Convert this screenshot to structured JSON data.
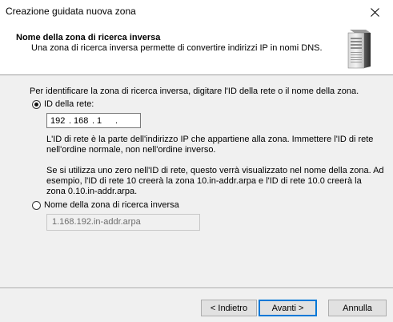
{
  "window": {
    "title": "Creazione guidata nuova zona"
  },
  "header": {
    "title": "Nome della zona di ricerca inversa",
    "subtitle": "Una zona di ricerca inversa permette di convertire indirizzi IP in nomi DNS."
  },
  "body": {
    "intro": "Per identificare la zona di ricerca inversa, digitare l'ID della rete o il nome della zona.",
    "option_network_id": {
      "label": "ID della rete:",
      "selected": true
    },
    "ip_segments": [
      "192",
      "168",
      "1",
      ""
    ],
    "help_line1": "L'ID di rete è la parte dell'indirizzo IP che appartiene alla zona. Immettere l'ID di rete",
    "help_line2": "nell'ordine normale, non nell'ordine inverso.",
    "help2_line1": "Se si utilizza uno zero nell'ID di rete, questo verrà visualizzato nel nome della zona. Ad",
    "help2_line2": "esempio, l'ID di rete 10 creerà la zona 10.in-addr.arpa e l'ID di rete 10.0 creerà la",
    "help2_line3": "zona 0.10.in-addr.arpa.",
    "option_zone_name": {
      "label": "Nome della zona di ricerca inversa",
      "selected": false
    },
    "zone_name_value": "1.168.192.in-addr.arpa"
  },
  "buttons": {
    "back": "< Indietro",
    "next": "Avanti >",
    "cancel": "Annulla"
  },
  "icons": {
    "close": "close-icon",
    "server": "server-icon"
  }
}
